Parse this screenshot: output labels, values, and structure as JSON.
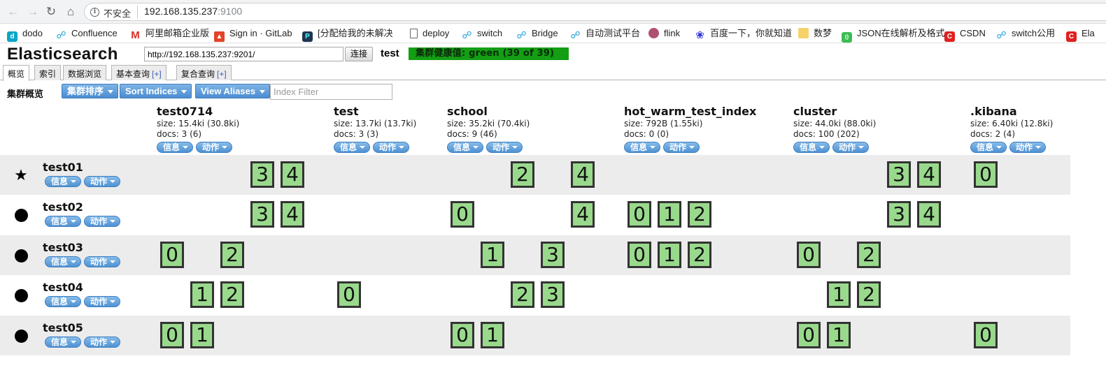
{
  "browser": {
    "security": "不安全",
    "url_host": "192.168.135.237",
    "url_port": ":9100",
    "bookmarks": [
      {
        "label": "dodo",
        "icon": "dodo-icon"
      },
      {
        "label": "Confluence",
        "icon": "link-icon"
      },
      {
        "label": "阿里邮箱企业版",
        "icon": "mail-icon"
      },
      {
        "label": "Sign in · GitLab",
        "icon": "gitlab-icon"
      },
      {
        "label": "[分配给我的未解决",
        "icon": "jira-icon"
      },
      {
        "label": "deploy",
        "icon": "document-icon"
      },
      {
        "label": "switch",
        "icon": "link-icon"
      },
      {
        "label": "Bridge",
        "icon": "link-icon"
      },
      {
        "label": "自动测试平台",
        "icon": "link-icon"
      },
      {
        "label": "flink",
        "icon": "flink-icon"
      },
      {
        "label": "百度一下，你就知道",
        "icon": "baidu-icon"
      },
      {
        "label": "数梦",
        "icon": "folder-icon"
      },
      {
        "label": "JSON在线解析及格式",
        "icon": "json-icon"
      },
      {
        "label": "CSDN",
        "icon": "csdn-icon"
      },
      {
        "label": "switch公用",
        "icon": "link-icon"
      },
      {
        "label": "Ela",
        "icon": "csdn-icon"
      }
    ]
  },
  "header": {
    "title": "Elasticsearch",
    "connect_url": "http://192.168.135.237:9201/",
    "connect_label": "连接",
    "cluster_name": "test",
    "health_label": "集群健康值: green (39 of 39)",
    "health_color": "#139e13"
  },
  "tabs": [
    {
      "label": "概览",
      "plus": ""
    },
    {
      "label": "索引",
      "plus": ""
    },
    {
      "label": "数据浏览",
      "plus": ""
    },
    {
      "label": "基本查询",
      "plus": "[+]"
    },
    {
      "label": "复合查询",
      "plus": "[+]"
    }
  ],
  "toolbar": {
    "section": "集群概览",
    "sort_cluster": "集群排序",
    "sort_indices": "Sort Indices",
    "view_aliases": "View Aliases",
    "filter_placeholder": "Index Filter"
  },
  "labels": {
    "info": "信息",
    "action": "动作"
  },
  "indices": [
    {
      "name": "test0714",
      "size": "size: 15.4ki (30.8ki)",
      "docs": "docs: 3 (6)"
    },
    {
      "name": "test",
      "size": "size: 13.7ki (13.7ki)",
      "docs": "docs: 3 (3)"
    },
    {
      "name": "school",
      "size": "size: 35.2ki (70.4ki)",
      "docs": "docs: 9 (46)"
    },
    {
      "name": "hot_warm_test_index",
      "size": "size: 792B (1.55ki)",
      "docs": "docs: 0 (0)"
    },
    {
      "name": "cluster",
      "size": "size: 44.0ki (88.0ki)",
      "docs": "docs: 100 (202)"
    },
    {
      "name": ".kibana",
      "size": "size: 6.40ki (12.8ki)",
      "docs": "docs: 2 (4)"
    }
  ],
  "nodes": [
    {
      "name": "test01",
      "marker": "star-icon",
      "shards": [
        [
          3,
          4
        ],
        [],
        [
          2,
          4
        ],
        [],
        [
          3,
          4
        ],
        [
          0
        ]
      ]
    },
    {
      "name": "test02",
      "marker": "dot-icon",
      "shards": [
        [
          3,
          4
        ],
        [],
        [
          0,
          4
        ],
        [
          0,
          1,
          2
        ],
        [
          3,
          4
        ],
        []
      ]
    },
    {
      "name": "test03",
      "marker": "dot-icon",
      "shards": [
        [
          0,
          2
        ],
        [],
        [
          1,
          3
        ],
        [
          0,
          1,
          2
        ],
        [
          0,
          2
        ],
        []
      ]
    },
    {
      "name": "test04",
      "marker": "dot-icon",
      "shards": [
        [
          1,
          2
        ],
        [
          0
        ],
        [
          2,
          3
        ],
        [],
        [
          1,
          2
        ],
        []
      ]
    },
    {
      "name": "test05",
      "marker": "dot-icon",
      "shards": [
        [
          0,
          1
        ],
        [],
        [
          0,
          1
        ],
        [],
        [
          0,
          1
        ],
        [
          0
        ]
      ]
    }
  ],
  "colors": {
    "shard_fill": "#99d98c",
    "button_blue": "#4a8dd0",
    "row_shade": "#ececec"
  }
}
